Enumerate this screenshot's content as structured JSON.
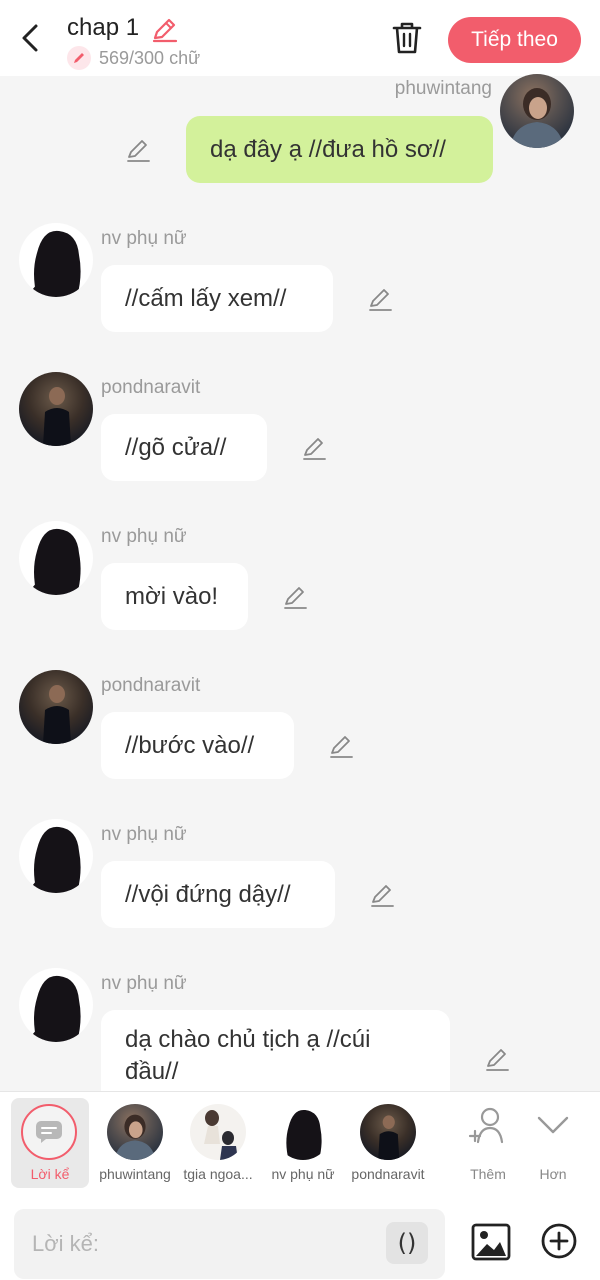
{
  "header": {
    "title": "chap 1",
    "word_count": "569/300 chữ",
    "next_label": "Tiếp theo"
  },
  "messages": [
    {
      "speaker": "phuwintang",
      "text": "dạ đây ạ //đưa hồ sơ//",
      "side": "right"
    },
    {
      "speaker": "nv phụ nữ",
      "text": "//cấm lấy xem//",
      "side": "left"
    },
    {
      "speaker": "pondnaravit",
      "text": "//gõ cửa//",
      "side": "left"
    },
    {
      "speaker": "nv phụ nữ",
      "text": "mời vào!",
      "side": "left"
    },
    {
      "speaker": "pondnaravit",
      "text": "//bước vào//",
      "side": "left"
    },
    {
      "speaker": "nv phụ nữ",
      "text": "//vội đứng dậy//",
      "side": "left"
    },
    {
      "speaker": "nv phụ nữ",
      "text": "dạ chào chủ tịch ạ //cúi đầu//",
      "side": "left"
    }
  ],
  "characters": {
    "narrator": "Lời kể",
    "items": [
      "phuwintang",
      "tgia ngoa...",
      "nv phụ nữ",
      "pondnaravit"
    ],
    "add_label": "Thêm",
    "more_label": "Hơn"
  },
  "input": {
    "placeholder": "Lời kể:",
    "paren_label": "()"
  },
  "colors": {
    "accent": "#f25d6c",
    "bubble_self": "#d3f19b",
    "bubble_other": "#ffffff",
    "background": "#f5f5f5"
  }
}
